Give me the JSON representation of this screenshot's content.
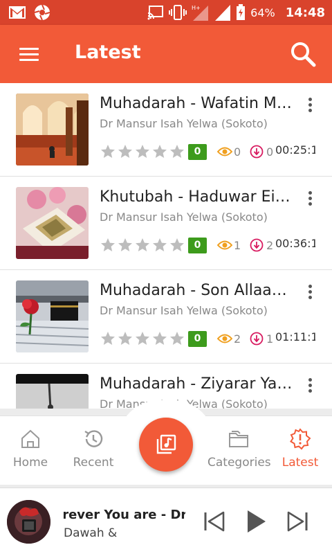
{
  "status_bar": {
    "battery_percent": "64%",
    "time": "14:48",
    "icons": [
      "gmail-icon",
      "aperture-icon",
      "cast-icon",
      "vibrate-icon",
      "signal-hplus-icon",
      "signal-icon",
      "battery-icon"
    ]
  },
  "app_bar": {
    "title": "Latest",
    "menu_icon": "hamburger-menu-icon",
    "search_icon": "search-icon"
  },
  "list": {
    "items": [
      {
        "title": "Muhadarah - Wafatin Ma...",
        "author": "Dr Mansur Isah Yelwa (Sokoto)",
        "rating": "0",
        "stars": 0,
        "views": "0",
        "downloads": "0",
        "duration": "00:25:1",
        "thumb": "mosque-interior"
      },
      {
        "title": "Khutubah - Haduwar Eid ...",
        "author": "Dr Mansur Isah Yelwa (Sokoto)",
        "rating": "0",
        "stars": 0,
        "views": "1",
        "downloads": "2",
        "duration": "00:36:1",
        "thumb": "quran-roses"
      },
      {
        "title": "Muhadarah - Son Allaah ...",
        "author": "Dr Mansur Isah Yelwa (Sokoto)",
        "rating": "0",
        "stars": 0,
        "views": "2",
        "downloads": "1",
        "duration": "01:11:1",
        "thumb": "kaaba-rose"
      },
      {
        "title": "Muhadarah - Ziyarar Yan...",
        "author": "Dr Mansur Isah Yelwa (Sokoto)",
        "rating": "",
        "stars": 0,
        "views": "",
        "downloads": "",
        "duration": "",
        "thumb": "bw-photo"
      }
    ]
  },
  "bottom_nav": {
    "items": [
      {
        "label": "Home",
        "icon": "home-icon",
        "active": false
      },
      {
        "label": "Recent",
        "icon": "history-icon",
        "active": false
      },
      {
        "label": "Categories",
        "icon": "folder-icon",
        "active": false
      },
      {
        "label": "Latest",
        "icon": "alert-badge-icon",
        "active": true
      }
    ],
    "center_icon": "music-library-icon"
  },
  "player": {
    "title": "erever You are - Dr",
    "subtitle": "Dawah &",
    "controls": [
      "skip-previous-icon",
      "play-icon",
      "skip-next-icon"
    ]
  },
  "colors": {
    "accent": "#f25a38",
    "status_bar": "#d9432c",
    "rating_badge": "#3d9b1c",
    "views_icon": "#f0a020",
    "downloads_icon": "#d81b60",
    "star_empty": "#bdbdbd"
  }
}
